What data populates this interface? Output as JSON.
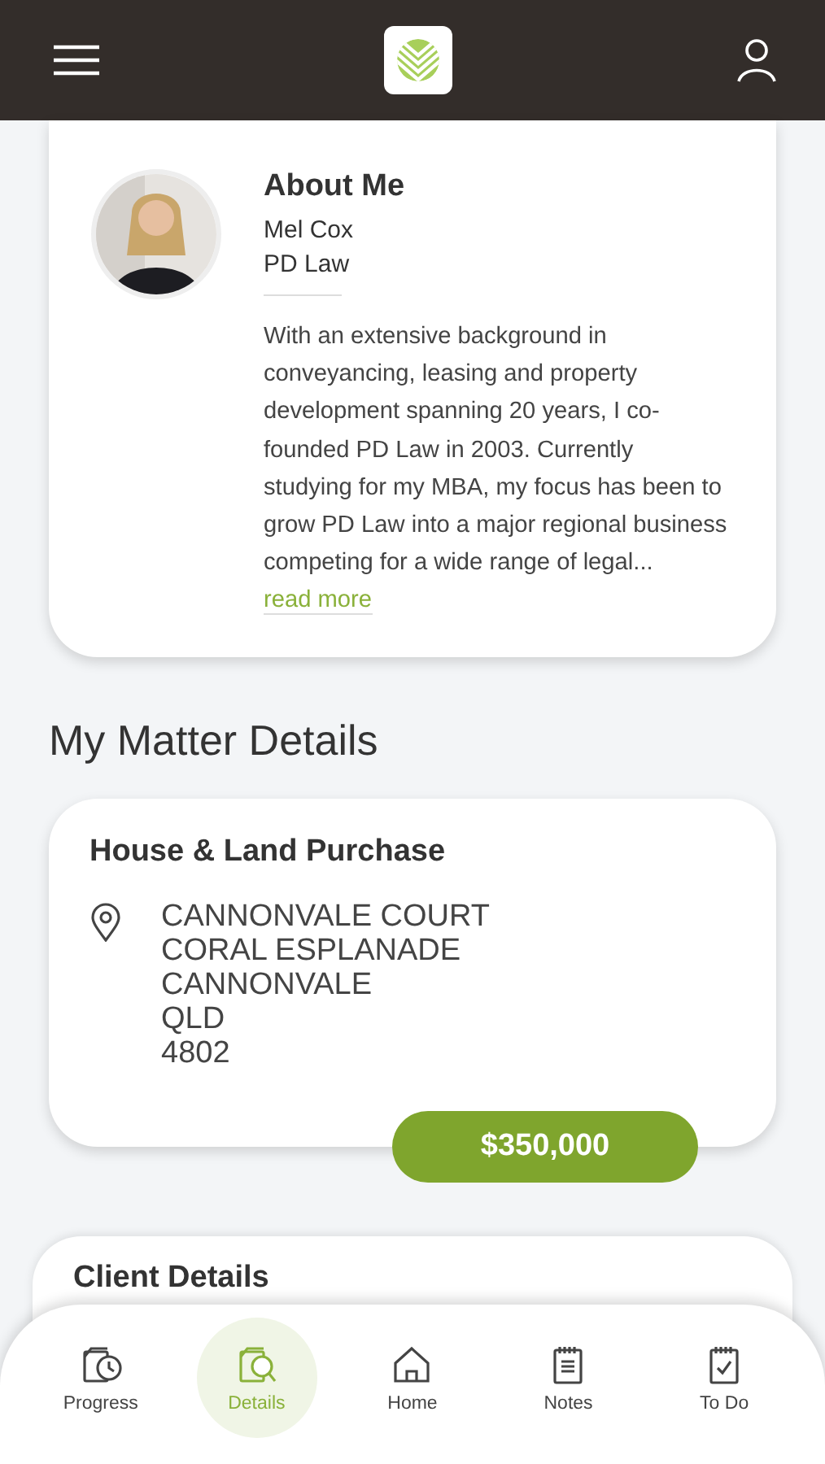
{
  "about": {
    "title": "About Me",
    "name": "Mel Cox",
    "company": "PD Law",
    "bio": "With an extensive background in conveyancing, leasing and property development spanning 20 years, I co-founded PD Law in 2003. Currently studying for my MBA, my focus has been to grow PD Law into a major regional business competing for a wide range of legal...",
    "link": "read more"
  },
  "section_title": "My Matter Details",
  "matter": {
    "title": "House & Land Purchase",
    "address": [
      "CANNONVALE COURT",
      "CORAL ESPLANADE",
      "CANNONVALE",
      "QLD",
      "4802"
    ],
    "price": "$350,000"
  },
  "client": {
    "title": "Client Details"
  },
  "nav": [
    {
      "label": "Progress",
      "kind": "progress",
      "selected": false
    },
    {
      "label": "Details",
      "kind": "details",
      "selected": true
    },
    {
      "label": "Home",
      "kind": "home",
      "selected": false
    },
    {
      "label": "Notes",
      "kind": "notes",
      "selected": false
    },
    {
      "label": "To Do",
      "kind": "todo",
      "selected": false
    }
  ]
}
